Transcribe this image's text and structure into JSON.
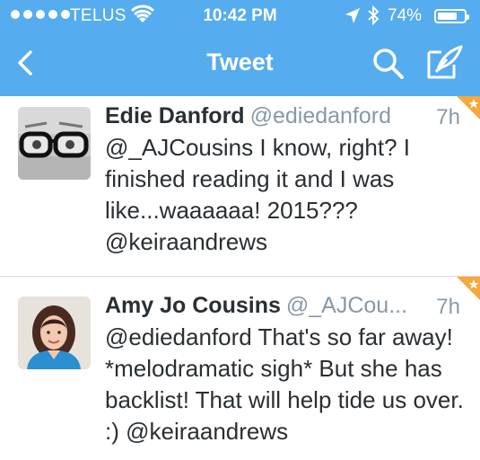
{
  "status": {
    "carrier": "TELUS",
    "time": "10:42 PM",
    "battery": "74%",
    "battery_level": 0.74
  },
  "nav": {
    "title": "Tweet"
  },
  "tweets": [
    {
      "name": "Edie Danford",
      "handle": "@ediedanford",
      "time": "7h",
      "text": "@_AJCousins I know, right? I finished reading it and I was like...waaaaaa! 2015??? @keiraandrews"
    },
    {
      "name": "Amy Jo Cousins",
      "handle": "@_AJCou...",
      "time": "7h",
      "text": "@ediedanford That's so far away! *melodramatic sigh* But she has backlist! That will help tide us over. :) @keiraandrews"
    }
  ],
  "colors": {
    "brand": "#55acee",
    "favorite": "#f4a93a",
    "text": "#292f33",
    "muted": "#8899a6"
  },
  "icons": {
    "back": "chevron-left-icon",
    "search": "search-icon",
    "compose": "compose-icon",
    "favorite": "star-icon"
  }
}
